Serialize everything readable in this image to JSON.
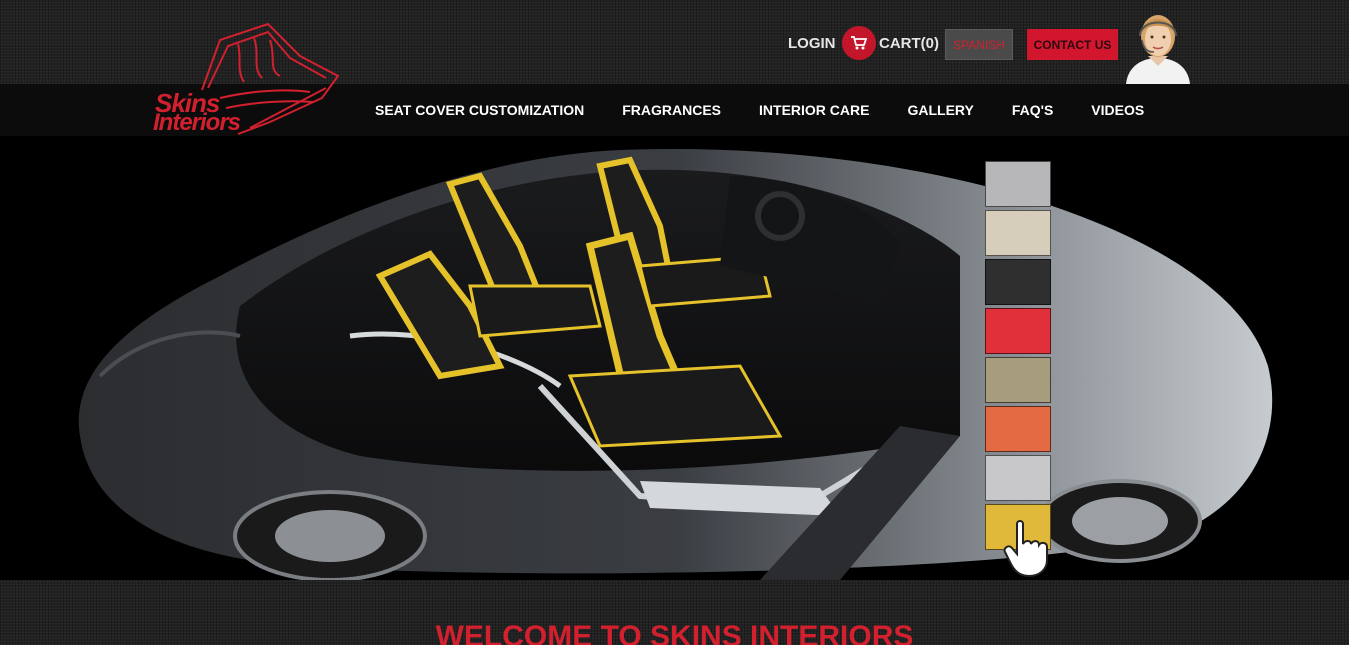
{
  "header": {
    "logo_line1": "Skins",
    "logo_line2": "Interiors",
    "login_label": "LOGIN",
    "cart_label": "CART(0)",
    "spanish_label": "SPANISH",
    "contact_label": "CONTACT US"
  },
  "nav": {
    "items": [
      {
        "label": "SEAT COVER CUSTOMIZATION"
      },
      {
        "label": "FRAGRANCES"
      },
      {
        "label": "INTERIOR CARE"
      },
      {
        "label": "GALLERY"
      },
      {
        "label": "FAQ'S"
      },
      {
        "label": "VIDEOS"
      }
    ]
  },
  "hero": {
    "swatches": [
      {
        "name": "silver",
        "color": "#b7b7b9"
      },
      {
        "name": "beige",
        "color": "#d6cdbb"
      },
      {
        "name": "black",
        "color": "#2f2f30"
      },
      {
        "name": "red",
        "color": "#e0313a"
      },
      {
        "name": "tan",
        "color": "#a89c7e"
      },
      {
        "name": "orange",
        "color": "#e46a44"
      },
      {
        "name": "light-gray",
        "color": "#c8c8ca"
      },
      {
        "name": "yellow",
        "color": "#e0b83a"
      }
    ]
  },
  "main": {
    "welcome_title": "WELCOME TO SKINS INTERIORS"
  },
  "colors": {
    "brand_red": "#d2202f",
    "accent_yellow": "#e5c12a"
  }
}
